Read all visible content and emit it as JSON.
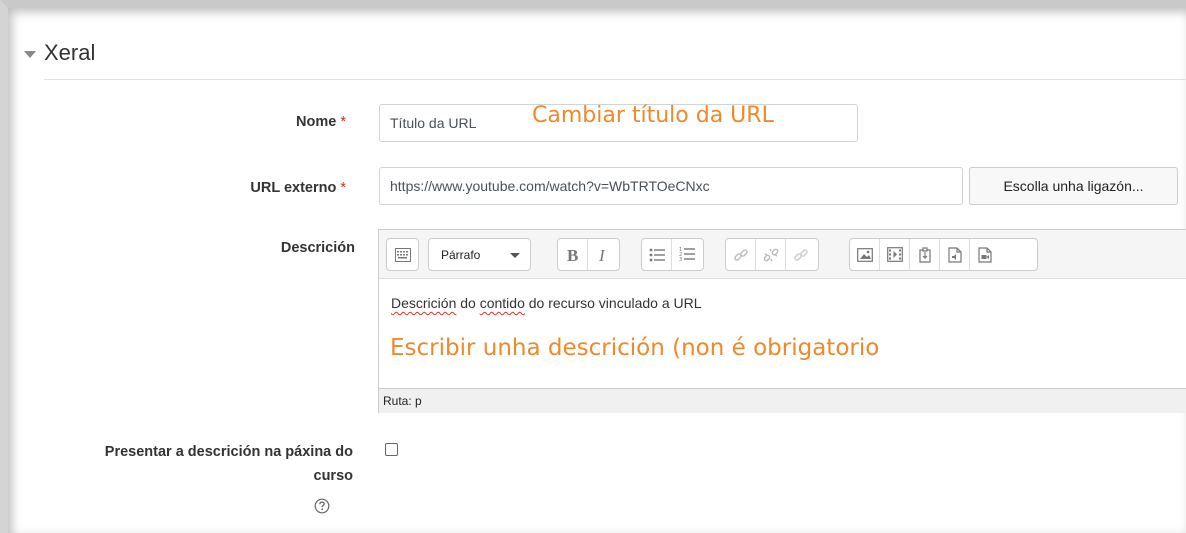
{
  "section": {
    "title": "Xeral"
  },
  "fields": {
    "name": {
      "label": "Nome",
      "required": "*",
      "value": "Título da URL",
      "annotation": "Cambiar título da URL"
    },
    "url": {
      "label": "URL externo",
      "required": "*",
      "value": "https://www.youtube.com/watch?v=WbTRTOeCNxc",
      "button": "Escolla unha ligazón..."
    },
    "description": {
      "label": "Descrición",
      "format_select": "Párrafo",
      "content_words": [
        "Descrición",
        " do ",
        "contido",
        " do recurso vinculado a URL"
      ],
      "annotation": "Escribir unha descrición (non é obrigatorio",
      "path": "Ruta: p"
    },
    "show_description": {
      "label_line1": "Presentar a descrición na páxina do",
      "label_line2": "curso",
      "checked": false
    }
  },
  "toolbar_icons": [
    "show-more-buttons-icon",
    "bold-icon",
    "italic-icon",
    "unordered-list-icon",
    "ordered-list-icon",
    "link-icon",
    "unlink-icon",
    "anchor-icon",
    "image-icon",
    "media-icon",
    "manage-files-icon",
    "record-audio-icon",
    "record-video-icon"
  ],
  "colors": {
    "annotation": "#f0882c",
    "required": "#c9302c"
  }
}
